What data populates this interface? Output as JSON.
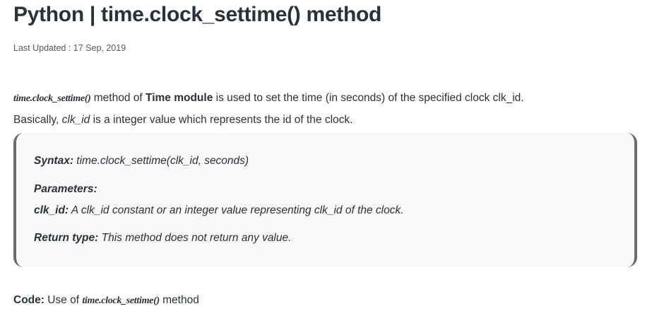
{
  "article": {
    "title": "Python | time.clock_settime() method",
    "last_updated": "Last Updated : 17 Sep, 2019"
  },
  "intro": {
    "fn_name": "time.clock_settime()",
    "text1": " method of ",
    "module": "Time module",
    "text2": " is used to set the time (in seconds) of the specified clock clk_id.",
    "line2_start": "Basically, ",
    "clk_id": "clk_id",
    "line2_end": " is a integer value which represents the id of the clock."
  },
  "box": {
    "syntax_label": "Syntax:",
    "syntax_value": " time.clock_settime(clk_id, seconds)",
    "params_label": "Parameters:",
    "param_name": "clk_id:",
    "param_desc": " A clk_id constant or an integer value representing clk_id of the clock.",
    "return_label": "Return type:",
    "return_desc": " This method does not return any value."
  },
  "code": {
    "label": "Code:",
    "text1": " Use of ",
    "fn_name": "time.clock_settime()",
    "text2": " method"
  }
}
